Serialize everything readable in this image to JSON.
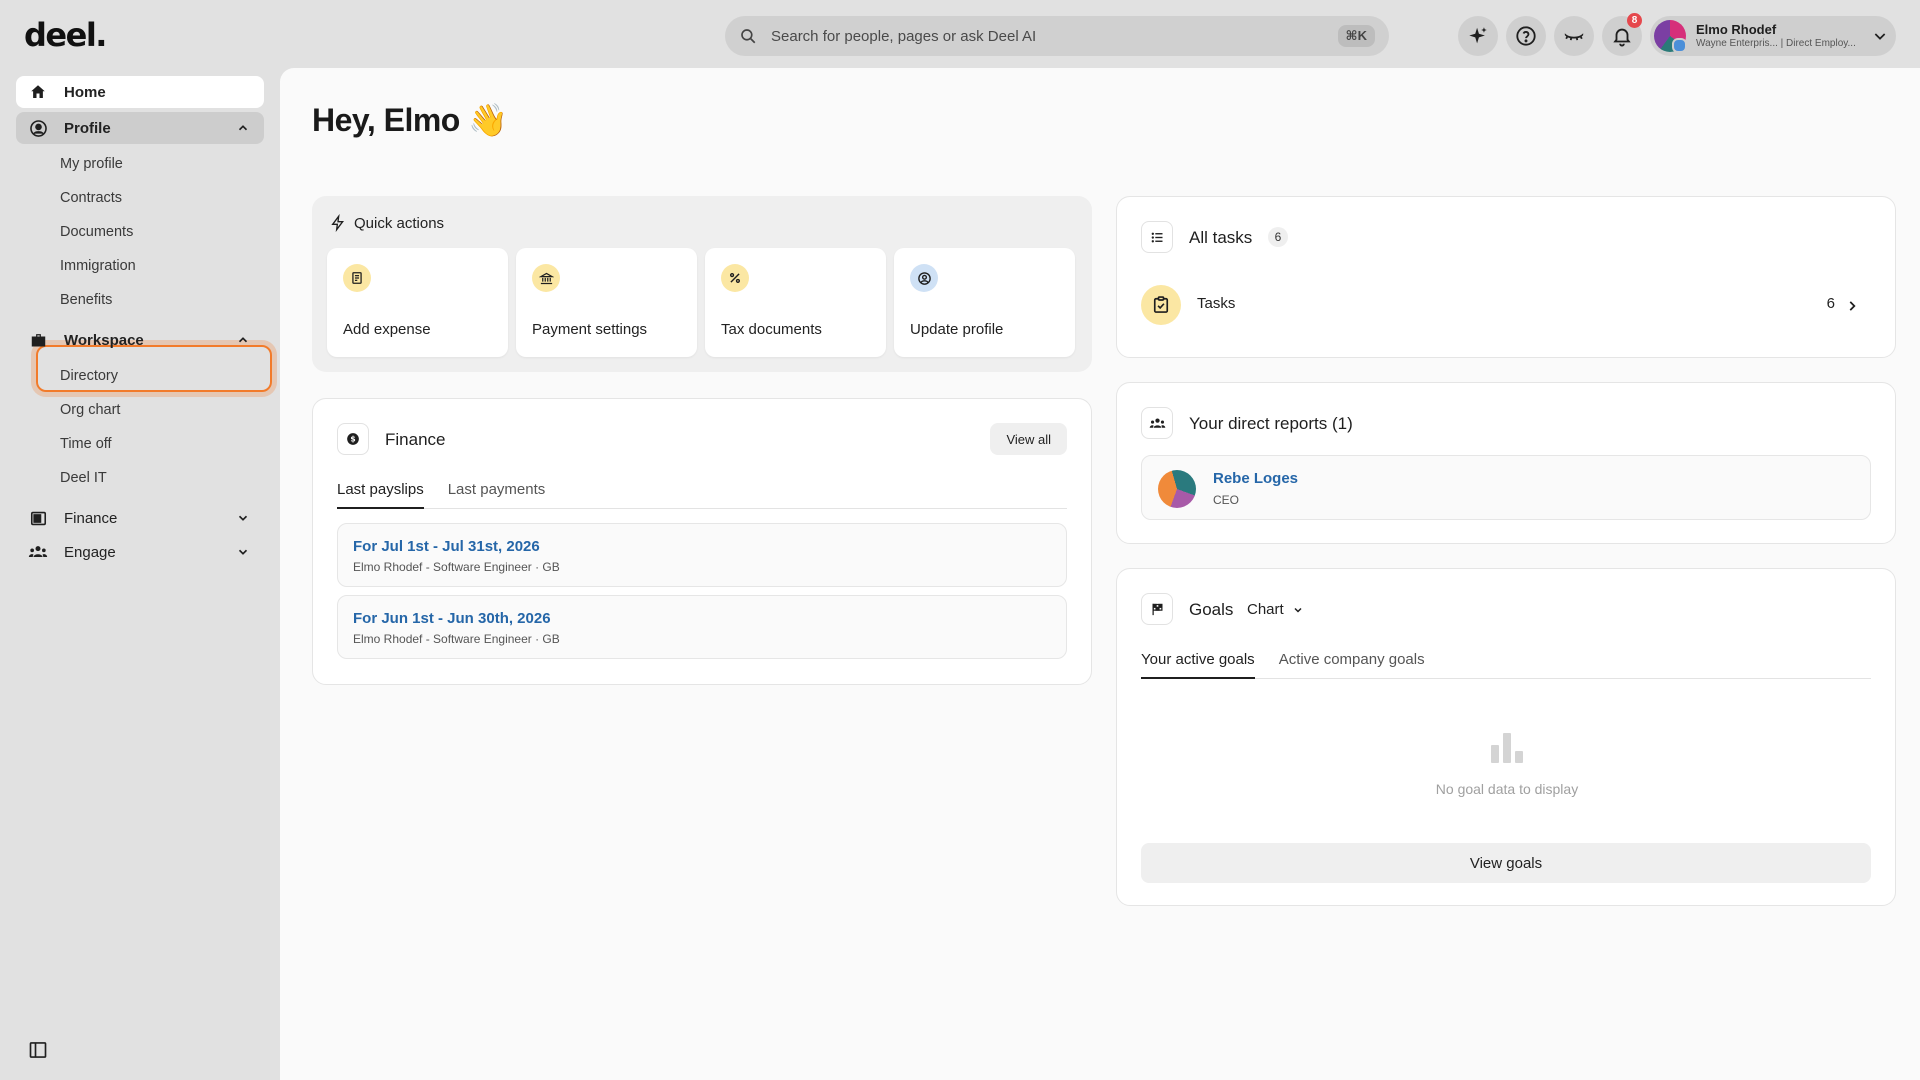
{
  "app": {
    "logo": "deel."
  },
  "search": {
    "placeholder": "Search for people, pages or ask Deel AI",
    "shortcut": "⌘K"
  },
  "notifications": {
    "count": "8"
  },
  "user": {
    "name": "Elmo Rhodef",
    "subtitle": "Wayne Enterpris... | Direct Employ..."
  },
  "sidebar": {
    "home": "Home",
    "profile": {
      "label": "Profile",
      "items": [
        "My profile",
        "Contracts",
        "Documents",
        "Immigration",
        "Benefits"
      ]
    },
    "workspace": {
      "label": "Workspace",
      "items": [
        "Directory",
        "Org chart",
        "Time off",
        "Deel IT"
      ]
    },
    "finance": "Finance",
    "engage": "Engage"
  },
  "main": {
    "greeting": "Hey, Elmo 👋",
    "quick_actions": {
      "title": "Quick actions",
      "items": [
        {
          "label": "Add expense",
          "icon": "receipt-icon"
        },
        {
          "label": "Payment settings",
          "icon": "bank-icon"
        },
        {
          "label": "Tax documents",
          "icon": "percent-icon"
        },
        {
          "label": "Update profile",
          "icon": "user-circle-icon"
        }
      ]
    },
    "finance": {
      "title": "Finance",
      "view_all": "View all",
      "tabs": [
        "Last payslips",
        "Last payments"
      ],
      "payslips": [
        {
          "title": "For Jul 1st - Jul 31st, 2026",
          "sub": "Elmo Rhodef - Software Engineer · GB"
        },
        {
          "title": "For Jun 1st - Jun 30th, 2026",
          "sub": "Elmo Rhodef - Software Engineer · GB"
        }
      ]
    },
    "tasks": {
      "title": "All tasks",
      "count": "6",
      "row_label": "Tasks",
      "row_count": "6"
    },
    "reports": {
      "title": "Your direct reports (1)",
      "people": [
        {
          "name": "Rebe Loges",
          "role": "CEO"
        }
      ]
    },
    "goals": {
      "title": "Goals",
      "view_mode": "Chart",
      "tabs": [
        "Your active goals",
        "Active company goals"
      ],
      "empty": "No goal data to display",
      "view_goals": "View goals"
    }
  },
  "colors": {
    "accent_link": "#2566a8",
    "highlight": "#f27b2a",
    "badge": "#e5484d"
  }
}
